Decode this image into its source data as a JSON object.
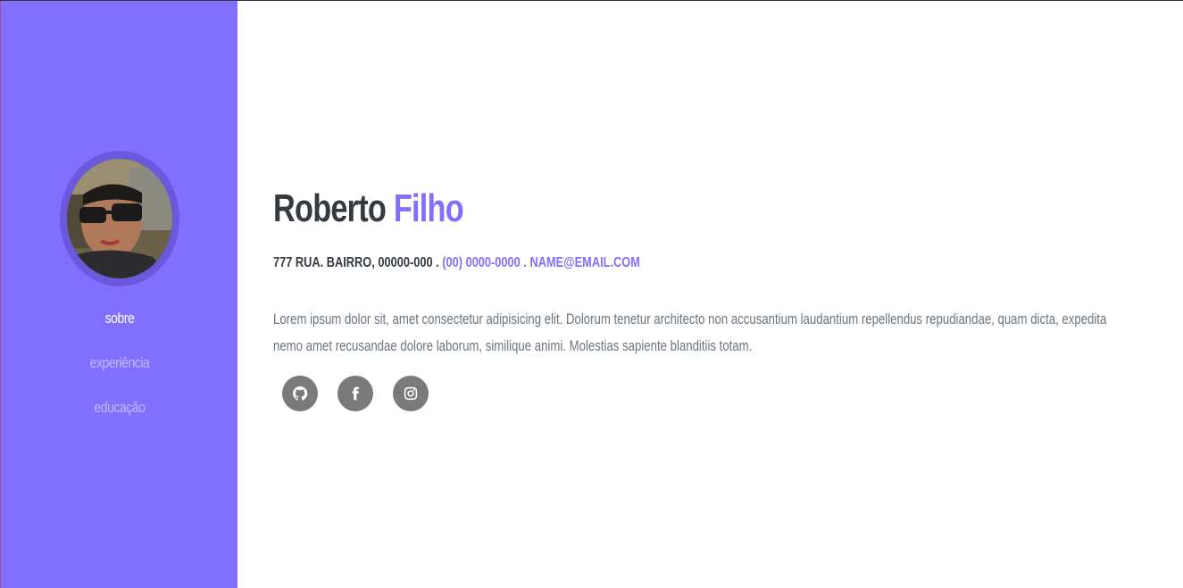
{
  "sidebar": {
    "background": "#8170ff",
    "avatar_alt": "profile-photo",
    "nav": [
      {
        "label": "sobre",
        "active": true
      },
      {
        "label": "experiência",
        "active": false
      },
      {
        "label": "educação",
        "active": false
      }
    ]
  },
  "profile": {
    "first_name": "Roberto",
    "last_name": "Filho",
    "address": "777 RUA. BAIRRO, 00000-000 .",
    "phone_email": "(00) 0000-0000 . NAME@EMAIL.COM",
    "bio": "Lorem ipsum dolor sit, amet consectetur adipisicing elit. Dolorum tenetur architecto non accusantium laudantium repellendus repudiandae, quam dicta, expedita nemo amet recusandae dolore laborum, similique animi. Molestias sapiente blanditiis totam."
  },
  "social": [
    {
      "icon": "github-icon"
    },
    {
      "icon": "facebook-icon"
    },
    {
      "icon": "instagram-icon"
    }
  ],
  "colors": {
    "accent": "#8170ff",
    "heading": "#343a40",
    "text": "#6c757d",
    "social_bg": "#7a7a7a"
  }
}
